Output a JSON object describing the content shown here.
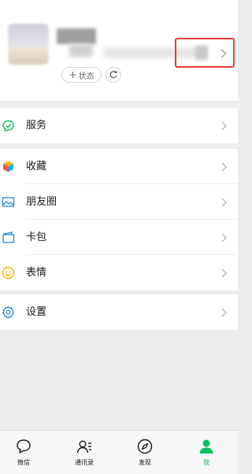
{
  "profile": {
    "status_label": "状态",
    "status_plus": "+"
  },
  "menu": {
    "services": "服务",
    "favorites": "收藏",
    "moments": "朋友圈",
    "cards": "卡包",
    "stickers": "表情",
    "settings": "设置"
  },
  "tabbar": {
    "chats": "微信",
    "contacts": "通讯录",
    "discover": "发现",
    "me": "我"
  },
  "colors": {
    "accent_green": "#07c160",
    "highlight_red": "#e53935",
    "icon_blue": "#1a88d6",
    "sticker_yellow": "#f5b400"
  }
}
